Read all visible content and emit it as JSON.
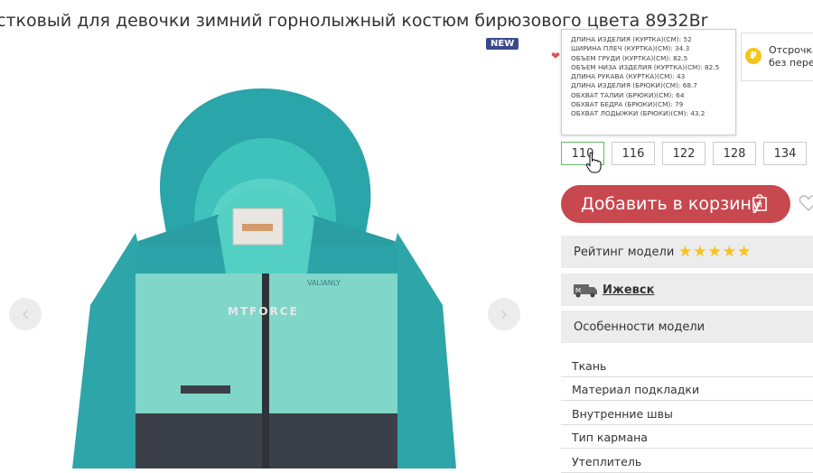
{
  "product": {
    "title": "стковый для девочки зимний горнолыжный костюм бирюзового цвета 8932Br",
    "badge": "NEW",
    "watermark": "MTFORCE"
  },
  "size_tooltip": {
    "lines": [
      "ДЛИНА ИЗДЕЛИЯ (КУРТКА)(СМ): 52",
      "ШИРИНА ПЛЕЧ (КУРТКА)(СМ): 34.3",
      "ОБЪЕМ ГРУДИ (КУРТКА)(СМ): 82.5",
      "ОБЪЕМ НИЗА ИЗДЕЛИЯ (КУРТКА)(СМ): 82.5",
      "ДЛИНА РУКАВА (КУРТКА)(СМ): 43",
      "ДЛИНА ИЗДЕЛИЯ (БРЮКИ)(СМ): 68.7",
      "ОБХВАТ ТАЛИИ (БРЮКИ)(СМ): 64",
      "ОБХВАТ БЕДРА (БРЮКИ)(СМ): 79",
      "ОБХВАТ ЛОДЫЖКИ (БРЮКИ)(СМ): 43.2"
    ]
  },
  "installment": {
    "line1": "Отсрочка",
    "line2": "без перег"
  },
  "sizes": [
    "110",
    "116",
    "122",
    "128",
    "134"
  ],
  "selected_size": "110",
  "cart": {
    "label": "Добавить в корзину"
  },
  "rating": {
    "label": "Рейтинг модели",
    "stars": "★★★★★",
    "value": 5
  },
  "city": {
    "label": "Ижевск"
  },
  "features": {
    "label": "Особенности модели"
  },
  "specs": [
    "Ткань",
    "Материал подкладки",
    "Внутренние швы",
    "Тип кармана",
    "Утеплитель"
  ],
  "colors": {
    "accent": "#c8484f",
    "selected_border": "#64b86a",
    "star": "#f7c21a",
    "jacket_teal": "#2ba5a8",
    "jacket_mint": "#7fd3c6",
    "jacket_dark": "#3b4048"
  }
}
